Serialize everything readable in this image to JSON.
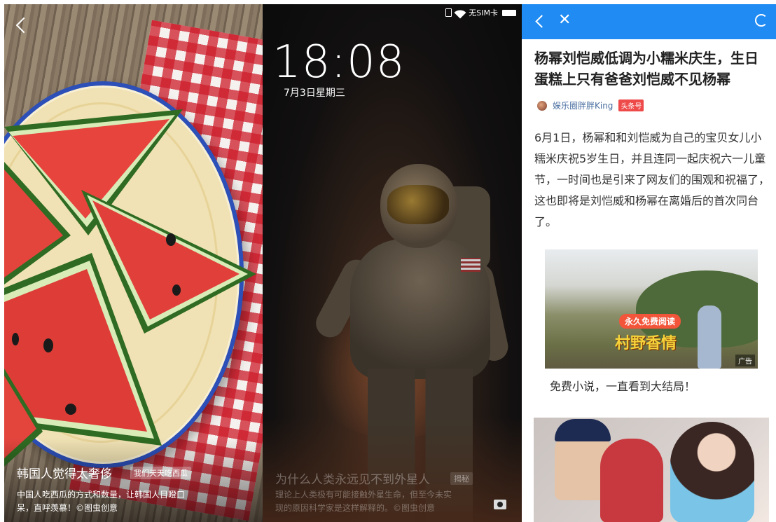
{
  "panel1": {
    "caption_title": "韩国人觉得太奢侈",
    "caption_tag": "我们天天吃西瓜",
    "caption_desc_line1": "中国人吃西瓜的方式和数量，让韩国人目瞪口",
    "caption_desc_line2": "呆，直呼羡慕！©图虫创意",
    "back_icon": "chevron-left-icon"
  },
  "panel2": {
    "status_text": "无SIM卡",
    "time": "18:08",
    "date": "7月3日星期三",
    "caption_title": "为什么人类永远见不到外星人",
    "caption_tag": "揭秘",
    "caption_desc_line1": "理论上人类极有可能接触外星生命，但至今未实",
    "caption_desc_line2": "现的原因科学家是这样解释的。©图虫创意",
    "camera_icon": "camera-icon"
  },
  "panel3": {
    "headline": "杨幂刘恺威低调为小糯米庆生，生日蛋糕上只有爸爸刘恺威不见杨幂",
    "author": "娱乐圈胖胖King",
    "author_tag": "头条号",
    "body": "6月1日，杨幂和和刘恺威为自己的宝贝女儿小糯米庆祝5岁生日，并且连同一起庆祝六一儿童节，一时间也是引来了网友们的围观和祝福了，这也即将是刘恺威和杨幂在离婚后的首次同台了。",
    "ad_pill": "永久免费阅读",
    "ad_title": "村野香情",
    "ad_label": "广告",
    "ad_caption": "免费小说，一直看到大结局！",
    "close_glyph": "✕",
    "accent_color": "#1f8bf3"
  }
}
